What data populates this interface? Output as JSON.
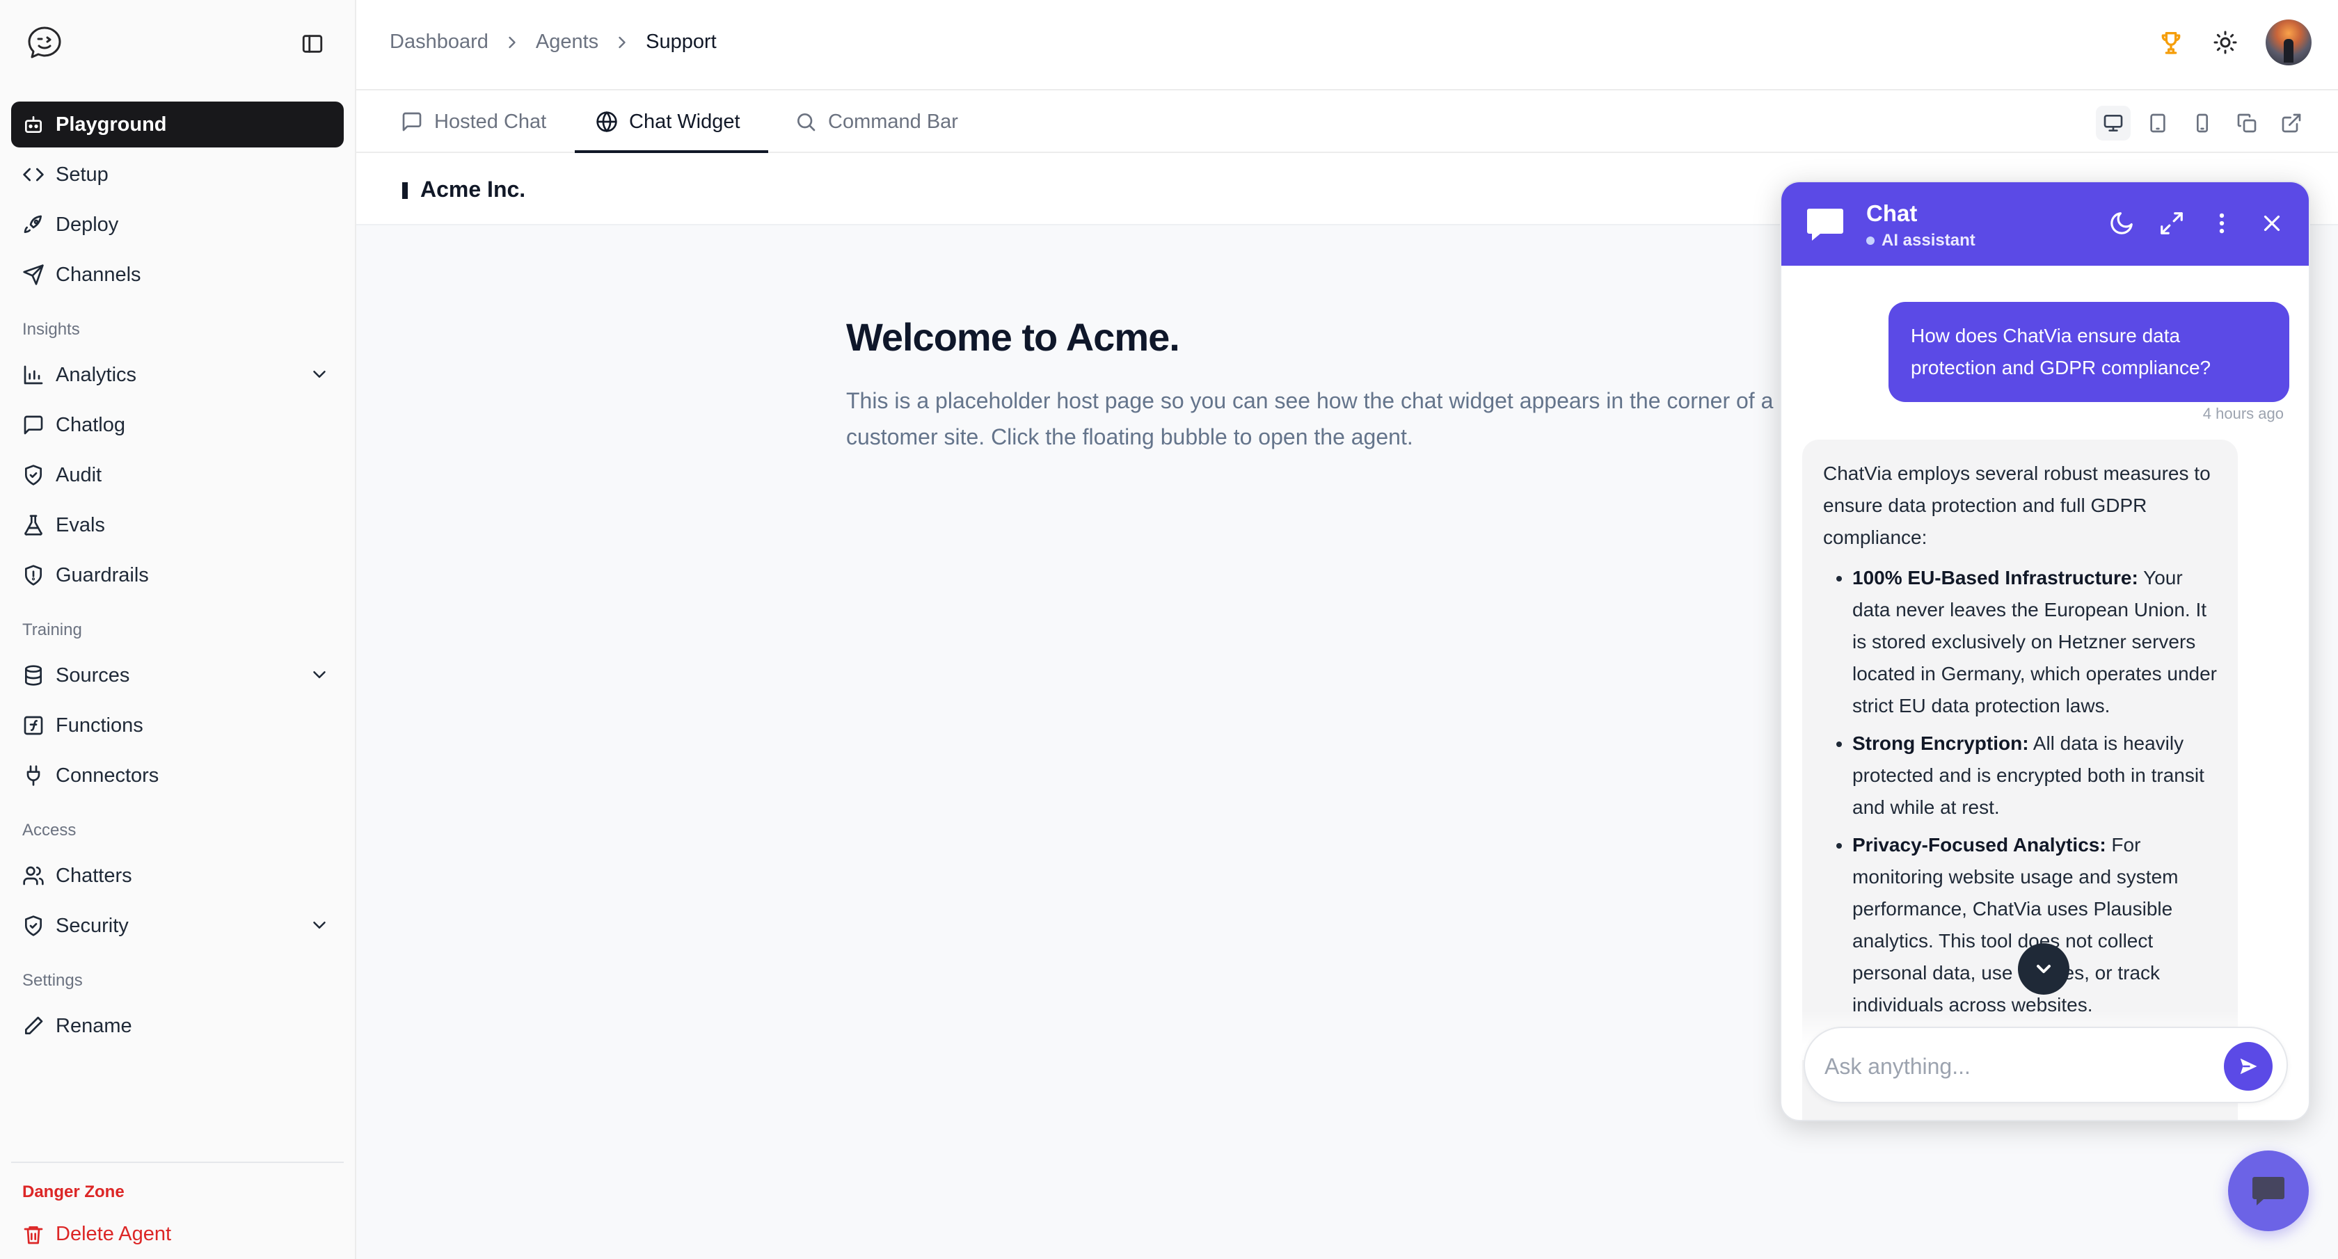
{
  "sidebar": {
    "logo_icon": "chat-wink-logo",
    "collapse_icon": "sidebar-panel-icon",
    "items": [
      {
        "label": "Playground",
        "icon": "bot-icon",
        "active": true
      },
      {
        "label": "Setup",
        "icon": "code-icon"
      },
      {
        "label": "Deploy",
        "icon": "rocket-icon"
      },
      {
        "label": "Channels",
        "icon": "send-icon"
      }
    ],
    "groups": [
      {
        "title": "Insights",
        "items": [
          {
            "label": "Analytics",
            "icon": "bar-chart-icon",
            "expandable": true
          },
          {
            "label": "Chatlog",
            "icon": "message-square-icon"
          },
          {
            "label": "Audit",
            "icon": "shield-check-icon"
          },
          {
            "label": "Evals",
            "icon": "flask-icon"
          },
          {
            "label": "Guardrails",
            "icon": "shield-icon"
          }
        ]
      },
      {
        "title": "Training",
        "items": [
          {
            "label": "Sources",
            "icon": "database-icon",
            "expandable": true
          },
          {
            "label": "Functions",
            "icon": "function-icon"
          },
          {
            "label": "Connectors",
            "icon": "plug-icon"
          }
        ]
      },
      {
        "title": "Access",
        "items": [
          {
            "label": "Chatters",
            "icon": "users-icon"
          },
          {
            "label": "Security",
            "icon": "shield-check-icon",
            "expandable": true
          }
        ]
      },
      {
        "title": "Settings",
        "items": [
          {
            "label": "Rename",
            "icon": "pencil-icon"
          }
        ]
      }
    ],
    "danger_zone": {
      "title": "Danger Zone",
      "delete_label": "Delete Agent",
      "icon": "trash-icon",
      "color": "#dc2626"
    }
  },
  "header": {
    "breadcrumbs": [
      "Dashboard",
      "Agents",
      "Support"
    ],
    "icons": [
      "trophy-icon",
      "sun-icon",
      "avatar"
    ]
  },
  "tabs": [
    {
      "label": "Hosted Chat",
      "icon": "message-square-icon"
    },
    {
      "label": "Chat Widget",
      "icon": "globe-icon",
      "active": true
    },
    {
      "label": "Command Bar",
      "icon": "search-icon"
    }
  ],
  "device_controls": [
    "desktop-icon",
    "tablet-icon",
    "mobile-icon",
    "copy-icon",
    "external-link-icon"
  ],
  "preview": {
    "host_name": "Acme Inc.",
    "welcome_title": "Welcome to Acme.",
    "welcome_body": "This is a placeholder host page so you can see how the chat widget appears in the corner of a customer site. Click the floating bubble to open the agent."
  },
  "widget": {
    "title": "Chat",
    "subtitle": "AI assistant",
    "accent": "#5b4ae6",
    "actions": [
      "moon-icon",
      "expand-icon",
      "more-vertical-icon",
      "close-icon"
    ],
    "user_message": "How does ChatVia ensure data protection and GDPR compliance?",
    "user_message_time": "4 hours ago",
    "bot_intro": "ChatVia employs several robust measures to ensure data protection and full GDPR compliance:",
    "bot_points": [
      {
        "title": "100% EU-Based Infrastructure:",
        "text": " Your data never leaves the European Union. It is stored exclusively on Hetzner servers located in Germany, which operates under strict EU data protection laws."
      },
      {
        "title": "Strong Encryption:",
        "text": " All data is heavily protected and is encrypted both in transit and while at rest."
      },
      {
        "title": "Privacy-Focused Analytics:",
        "text": " For monitoring website usage and system performance, ChatVia uses Plausible analytics. This tool does not collect personal data, use cookies, or track individuals across websites."
      }
    ],
    "input_placeholder": "Ask anything..."
  }
}
